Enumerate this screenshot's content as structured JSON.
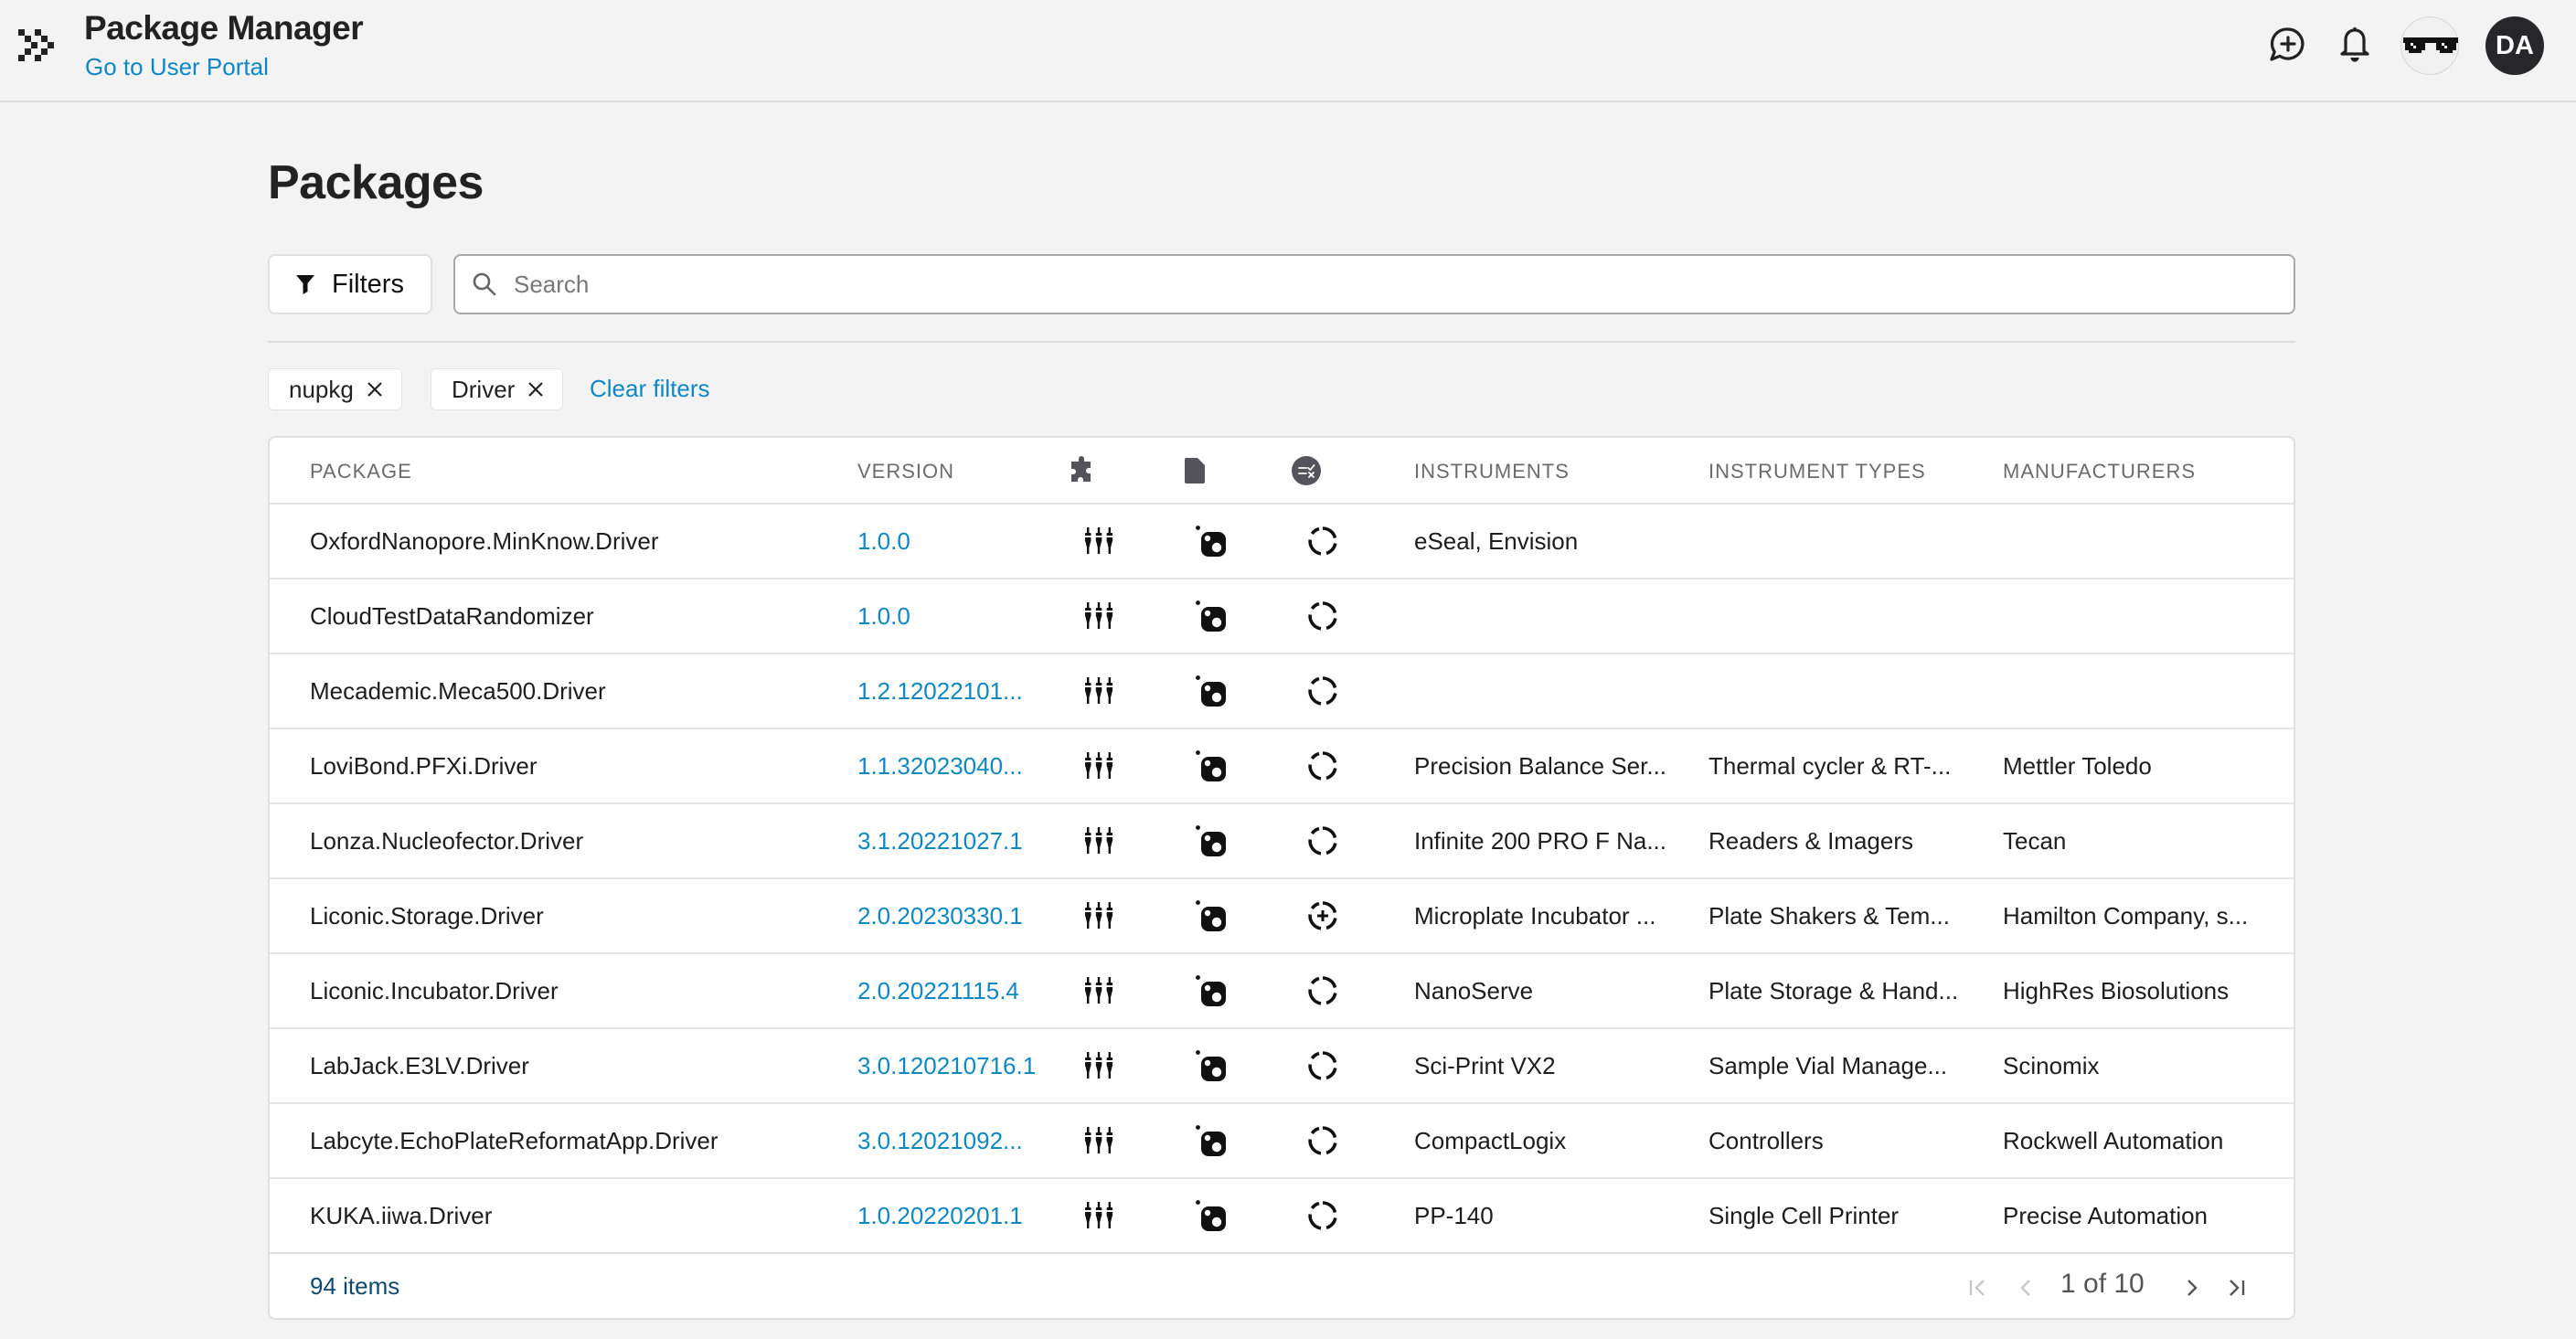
{
  "header": {
    "app_title": "Package Manager",
    "portal_link": "Go to User Portal",
    "icons": [
      "logo-chevrons-icon",
      "chat-plus-icon",
      "bell-icon",
      "sunglasses-avatar",
      "user-avatar"
    ],
    "user_initials": "DA"
  },
  "page": {
    "title": "Packages"
  },
  "toolbar": {
    "filters_label": "Filters",
    "search_placeholder": "Search",
    "search_value": ""
  },
  "active_filters": {
    "chips": [
      {
        "label": "nupkg"
      },
      {
        "label": "Driver"
      }
    ],
    "clear_label": "Clear filters"
  },
  "table": {
    "columns": {
      "package": "PACKAGE",
      "version": "VERSION",
      "icon_col_1": "puzzle-icon",
      "icon_col_2": "document-icon",
      "icon_col_3": "checklist-icon",
      "instruments": "INSTRUMENTS",
      "instrument_types": "INSTRUMENT TYPES",
      "manufacturers": "MANUFACTURERS"
    },
    "rows": [
      {
        "package": "OxfordNanopore.MinKnow.Driver",
        "version": "1.0.0",
        "status": "progress",
        "instruments": "eSeal, Envision",
        "types": "",
        "manufacturers": ""
      },
      {
        "package": "CloudTestDataRandomizer",
        "version": "1.0.0",
        "status": "progress",
        "instruments": "",
        "types": "",
        "manufacturers": ""
      },
      {
        "package": "Mecademic.Meca500.Driver",
        "version": "1.2.12022101...",
        "status": "progress",
        "instruments": "",
        "types": "",
        "manufacturers": ""
      },
      {
        "package": "LoviBond.PFXi.Driver",
        "version": "1.1.32023040...",
        "status": "progress",
        "instruments": "Precision Balance Ser...",
        "types": "Thermal cycler & RT-...",
        "manufacturers": "Mettler Toledo"
      },
      {
        "package": "Lonza.Nucleofector.Driver",
        "version": "3.1.20221027.1",
        "status": "progress",
        "instruments": "Infinite 200 PRO F Na...",
        "types": "Readers & Imagers",
        "manufacturers": "Tecan"
      },
      {
        "package": "Liconic.Storage.Driver",
        "version": "2.0.20230330.1",
        "status": "progress-plus",
        "instruments": "Microplate Incubator ...",
        "types": "Plate Shakers & Tem...",
        "manufacturers": "Hamilton Company, s..."
      },
      {
        "package": "Liconic.Incubator.Driver",
        "version": "2.0.20221115.4",
        "status": "progress",
        "instruments": "NanoServe",
        "types": "Plate Storage & Hand...",
        "manufacturers": "HighRes Biosolutions"
      },
      {
        "package": "LabJack.E3LV.Driver",
        "version": "3.0.120210716.1",
        "status": "progress",
        "instruments": "Sci-Print VX2",
        "types": "Sample Vial Manage...",
        "manufacturers": "Scinomix"
      },
      {
        "package": "Labcyte.EchoPlateReformatApp.Driver",
        "version": "3.0.12021092...",
        "status": "progress",
        "instruments": "CompactLogix",
        "types": "Controllers",
        "manufacturers": "Rockwell Automation"
      },
      {
        "package": "KUKA.iiwa.Driver",
        "version": "1.0.20220201.1",
        "status": "progress",
        "instruments": "PP-140",
        "types": "Single Cell Printer",
        "manufacturers": "Precise Automation"
      }
    ],
    "row_icons": {
      "col_1": "connector-plugs-icon",
      "col_2": "nuget-package-icon"
    }
  },
  "footer": {
    "items_count": "94 items",
    "page_info": "1 of 10",
    "current_page": 1,
    "total_pages": 10
  },
  "colors": {
    "accent": "#0e87c5",
    "background": "#f3f3f3",
    "text": "#222222",
    "avatar": "#27272a"
  }
}
